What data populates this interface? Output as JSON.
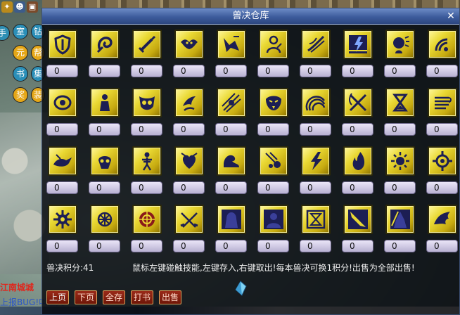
{
  "window": {
    "title": "兽决仓库",
    "close_icon": "close-icon",
    "points_label": "兽决积分:41",
    "hint": "鼠标左键碰触技能,左键存入,右键取出!每本兽决可换1积分!出售为全部出售!"
  },
  "buttons": [
    {
      "label": "上页",
      "color": "#f4f4f4"
    },
    {
      "label": "下页",
      "color": "#ffd8c8"
    },
    {
      "label": "全存",
      "color": "#ffd8c8"
    },
    {
      "label": "打书",
      "color": "#ffd8c8"
    },
    {
      "label": "出售",
      "color": "#ffd8c8"
    }
  ],
  "skills": [
    {
      "icon": "shield-icon",
      "count": "0"
    },
    {
      "icon": "swirl-hook-icon",
      "count": "0"
    },
    {
      "icon": "sword-icon",
      "count": "0"
    },
    {
      "icon": "bat-icon",
      "count": "0"
    },
    {
      "icon": "fist-strike-icon",
      "count": "0"
    },
    {
      "icon": "figure-rune-icon",
      "count": "0"
    },
    {
      "icon": "wind-slash-icon",
      "count": "0"
    },
    {
      "icon": "lightning-ground-icon",
      "count": "0"
    },
    {
      "icon": "head-glow-icon",
      "count": "0"
    },
    {
      "icon": "wave-rings-icon",
      "count": "0"
    },
    {
      "icon": "eye-icon",
      "count": "0"
    },
    {
      "icon": "statue-icon",
      "count": "0"
    },
    {
      "icon": "owl-mask-icon",
      "count": "0"
    },
    {
      "icon": "claw-swipe-icon",
      "count": "0"
    },
    {
      "icon": "burst-slash-icon",
      "count": "0"
    },
    {
      "icon": "serpent-mask-icon",
      "count": "0"
    },
    {
      "icon": "rainbow-arc-icon",
      "count": "0"
    },
    {
      "icon": "crossed-blades-icon",
      "count": "0"
    },
    {
      "icon": "hourglass-icon",
      "count": "0"
    },
    {
      "icon": "wind-scroll-icon",
      "count": "0"
    },
    {
      "icon": "beast-leap-icon",
      "count": "0"
    },
    {
      "icon": "skull-icon",
      "count": "0"
    },
    {
      "icon": "skeleton-icon",
      "count": "0"
    },
    {
      "icon": "heart-crest-icon",
      "count": "0"
    },
    {
      "icon": "water-wave-icon",
      "count": "0"
    },
    {
      "icon": "meteor-icon",
      "count": "0"
    },
    {
      "icon": "lightning-icon",
      "count": "0"
    },
    {
      "icon": "flame-icon",
      "count": "0"
    },
    {
      "icon": "sun-crest-icon",
      "count": "0"
    },
    {
      "icon": "spiked-ring-icon",
      "count": "0"
    },
    {
      "icon": "gear-seal-icon",
      "count": "0"
    },
    {
      "icon": "dharma-wheel-icon",
      "count": "0"
    },
    {
      "icon": "red-rune-icon",
      "count": "0"
    },
    {
      "icon": "crossed-swords-icon",
      "count": "0"
    },
    {
      "icon": "hooded-figure-icon",
      "count": "0"
    },
    {
      "icon": "bust-silhouette-icon",
      "count": "0"
    },
    {
      "icon": "hourglass-frame-icon",
      "count": "0"
    },
    {
      "icon": "blade-wing-icon",
      "count": "0"
    },
    {
      "icon": "hooded-mage-icon",
      "count": "0"
    },
    {
      "icon": "eagle-wing-icon",
      "count": "0"
    }
  ],
  "background": {
    "side_buttons": [
      "手",
      "室",
      "钻",
      "元",
      "帮",
      "书",
      "集",
      "奖",
      "装"
    ],
    "red_text": "江南城城",
    "blue_text": "上报BUG!叫工具",
    "hud_icons": [
      "hud-trophy-icon",
      "hud-user-icon",
      "hud-chest-icon"
    ]
  },
  "colors": {
    "tile_gold": "#e9d833",
    "icon_dark": "#1c1e54",
    "count_bg": "#cfc9e6",
    "button_bg": "#8a2412"
  }
}
